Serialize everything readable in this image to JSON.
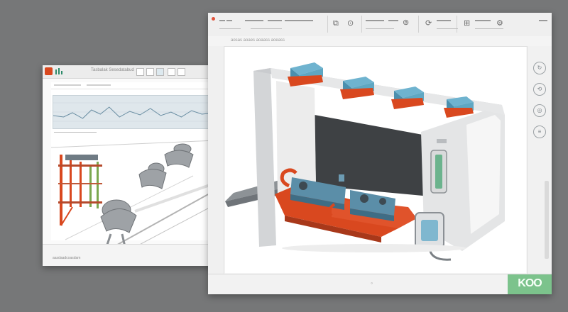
{
  "back_window": {
    "menu_text": "Tasbalak Sesedatabud",
    "status_text": "aasdaadcoasdam"
  },
  "front_window": {
    "toolbar_icons": [
      "copy-icon",
      "search-icon",
      "compass-icon",
      "sync-icon",
      "grid-icon",
      "settings-icon"
    ],
    "subbar_text": "aosas  aoaes  aoaass  aoeass",
    "bottom_zoom": "◦",
    "brand_label": "KOO",
    "right_panel_icons": [
      "refresh-icon",
      "rotate-icon",
      "target-icon",
      "layers-icon"
    ]
  },
  "colors": {
    "desktop": "#767778",
    "accent_red": "#d9481f",
    "accent_teal": "#5ea7c3",
    "brand_green": "#7cc38c"
  }
}
